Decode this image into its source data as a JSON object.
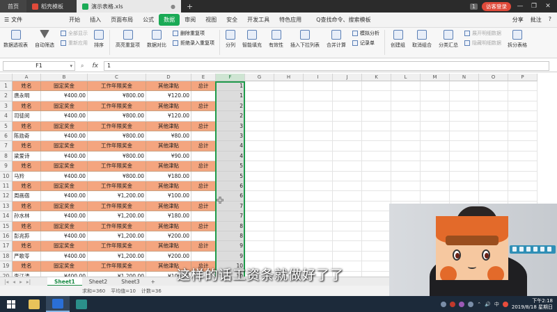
{
  "titlebar": {
    "tabs": [
      {
        "label": "首页"
      },
      {
        "label": "稻壳模板"
      },
      {
        "label": "演示表格.xls"
      }
    ],
    "new_tab": "+",
    "page_badge": "1",
    "login": "访客登录",
    "minimize": "—",
    "restore": "❐",
    "close": "✕"
  },
  "menubar": {
    "file": "文件",
    "items": [
      "开始",
      "插入",
      "页面布局",
      "公式",
      "数据",
      "审阅",
      "视图",
      "安全",
      "开发工具",
      "特色应用"
    ],
    "active": "数据",
    "search": "Q查找命令、搜索模板",
    "right": [
      "分享",
      "批注",
      "?"
    ]
  },
  "ribbon": {
    "pivot": "数据透视表",
    "autofilter": "自动筛选",
    "show_all": "全部显示",
    "reapply": "重新应用",
    "sort": "排序",
    "highlight_dup": "高亮重复项",
    "compare": "数据对比",
    "remove_dup": "删除重复项",
    "reject_dup": "拒绝录入重复项",
    "split": "分列",
    "smart_fill": "智能填充",
    "validity": "有效性",
    "dropdown": "插入下拉列表",
    "consolidate": "合并计算",
    "simulate": "模拟分析",
    "record": "记录单",
    "create_group": "创建组",
    "ungroup": "取消组合",
    "subtotal": "分类汇总",
    "show_detail": "展开明细数据",
    "hide_detail": "隐藏明细数据",
    "split_table": "拆分表格"
  },
  "formula_bar": {
    "namebox": "F1",
    "fx": "fx",
    "value": "1"
  },
  "columns": [
    "A",
    "B",
    "C",
    "D",
    "E",
    "F",
    "G",
    "H",
    "I",
    "J",
    "K",
    "L",
    "M",
    "N",
    "O",
    "P"
  ],
  "selected_column": "F",
  "table": {
    "header": [
      "姓名",
      "固定奖金",
      "工作年限奖金",
      "其他津贴",
      "总计"
    ],
    "rows": [
      {
        "name": "唐永明",
        "fixed": "¥400.00",
        "years": "¥800.00",
        "other": "¥120.00",
        "total": "",
        "f": "1"
      },
      {
        "name": "司徒闵",
        "fixed": "¥400.00",
        "years": "¥800.00",
        "other": "¥120.00",
        "total": "",
        "f": "2"
      },
      {
        "name": "陈勋奇",
        "fixed": "¥400.00",
        "years": "¥800.00",
        "other": "¥80.00",
        "total": "",
        "f": "3"
      },
      {
        "name": "梁爱诗",
        "fixed": "¥400.00",
        "years": "¥800.00",
        "other": "¥90.00",
        "total": "",
        "f": "4"
      },
      {
        "name": "马羚",
        "fixed": "¥400.00",
        "years": "¥800.00",
        "other": "¥180.00",
        "total": "",
        "f": "5"
      },
      {
        "name": "周画宿",
        "fixed": "¥400.00",
        "years": "¥1,200.00",
        "other": "¥100.00",
        "total": "",
        "f": "6"
      },
      {
        "name": "孙水林",
        "fixed": "¥400.00",
        "years": "¥1,200.00",
        "other": "¥180.00",
        "total": "",
        "f": "7"
      },
      {
        "name": "彭兆荪",
        "fixed": "¥400.00",
        "years": "¥1,200.00",
        "other": "¥200.00",
        "total": "",
        "f": "8"
      },
      {
        "name": "严歌苓",
        "fixed": "¥400.00",
        "years": "¥1,200.00",
        "other": "¥200.00",
        "total": "",
        "f": "9"
      },
      {
        "name": "李江涛",
        "fixed": "¥400.00",
        "years": "¥1,200.00",
        "other": "¥100.00",
        "total": "",
        "f": "10"
      }
    ],
    "header_f_values": [
      "1",
      "2",
      "3",
      "4",
      "5",
      "6",
      "7",
      "8",
      "9",
      "10"
    ]
  },
  "sheets": [
    "Sheet1",
    "Sheet2",
    "Sheet3"
  ],
  "active_sheet": "Sheet1",
  "status": {
    "sum": "求和=360",
    "avg": "平均值=10",
    "count": "计数=36"
  },
  "subtitle": "这样的话工资条就做好了了",
  "clock": {
    "time": "下午2:18",
    "date": "2019/8/18 星期日"
  },
  "colors": {
    "header_fill": "#f4a57f",
    "accent_green": "#1aaa55",
    "selection_border": "#1e9b4a"
  }
}
